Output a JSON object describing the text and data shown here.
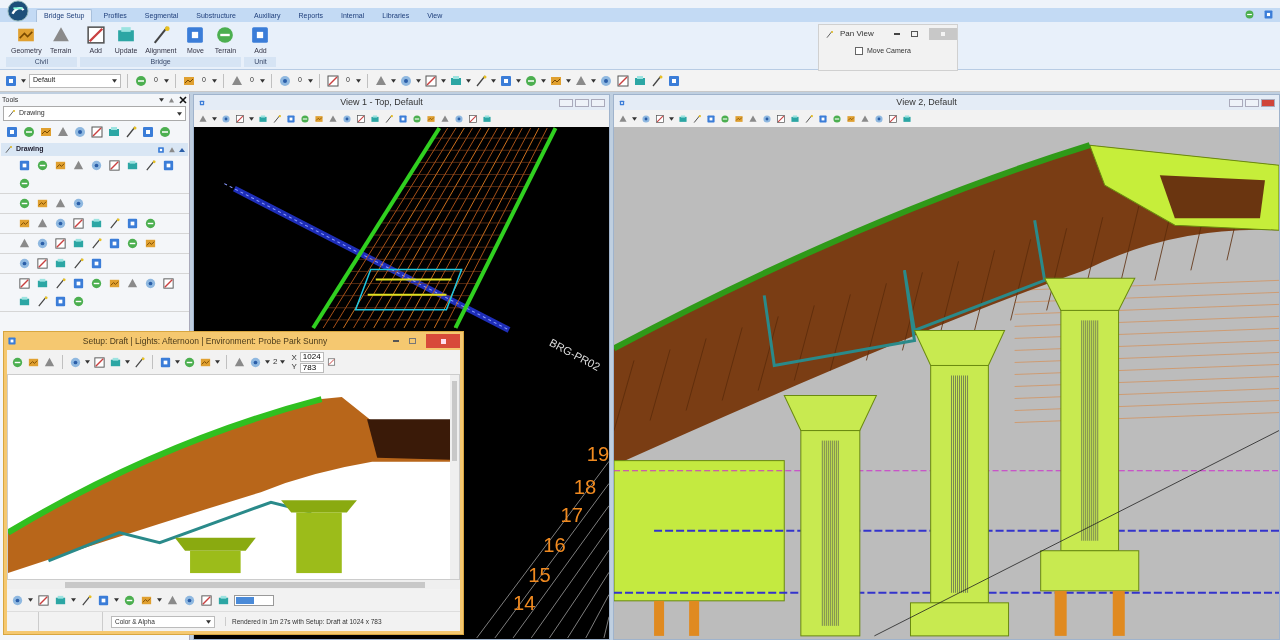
{
  "ribbon": {
    "tabs": [
      {
        "label": "Bridge Setup",
        "selected": true
      },
      {
        "label": "Profiles",
        "selected": false
      },
      {
        "label": "Segmental",
        "selected": false
      },
      {
        "label": "Substructure",
        "selected": false
      },
      {
        "label": "Auxiliary",
        "selected": false
      },
      {
        "label": "Reports",
        "selected": false
      },
      {
        "label": "Internal",
        "selected": false
      },
      {
        "label": "Libraries",
        "selected": false
      },
      {
        "label": "View",
        "selected": false
      }
    ],
    "groups": [
      {
        "label": "Civil",
        "buttons": [
          "Geometry",
          "Terrain"
        ]
      },
      {
        "label": "Bridge",
        "buttons": [
          "Add",
          "Update",
          "Alignment",
          "Move",
          "Terrain"
        ]
      },
      {
        "label": "Unit",
        "buttons": [
          "Add"
        ]
      }
    ]
  },
  "pan_view_dialog": {
    "title": "Pan View",
    "option": {
      "label": "Move Camera",
      "checked": false
    }
  },
  "attributes_toolbar": {
    "fields": [
      "Default",
      "0",
      "0",
      "0",
      "0",
      "0"
    ]
  },
  "tools_panel": {
    "title": "Tools",
    "selector": "Drawing",
    "section": {
      "label": "Drawing",
      "expanded": true
    }
  },
  "views": [
    {
      "kind": "top",
      "title": "View 1 - Top, Default",
      "alignment_label": "BRG-PR02",
      "stations": [
        "19",
        "18",
        "17",
        "16",
        "15",
        "14"
      ]
    },
    {
      "kind": "perspective",
      "title": "View 2, Default"
    }
  ],
  "render_window": {
    "title": "Setup: Draft | Lights: Afternoon | Environment: Probe Park Sunny",
    "count": "2",
    "x_label": "X",
    "x_value": "1024",
    "y_label": "Y",
    "y_value": "783",
    "channel": "Color & Alpha",
    "status": "Rendered in 1m 27s with Setup: Draft at 1024 x 783"
  }
}
